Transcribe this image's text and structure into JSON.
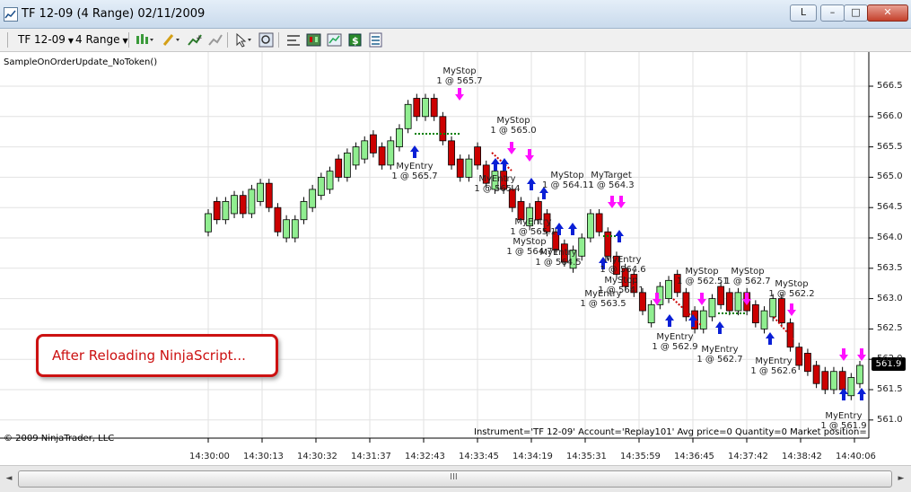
{
  "window": {
    "title": "TF 12-09 (4 Range)  02/11/2009",
    "btn_l": "L",
    "btn_min": "–",
    "btn_max": "□",
    "btn_close": "✕"
  },
  "toolbar": {
    "instrument": "TF 12-09",
    "period": "4 Range",
    "icons": [
      "chart-style-icon",
      "draw-pencil-icon",
      "add-indicator-icon",
      "remove-indicator-icon",
      "cursor-icon",
      "zoom-icon",
      "properties-icon",
      "data-box-icon",
      "chart-trader-icon",
      "strategy-icon",
      "template-icon"
    ]
  },
  "chart": {
    "indicator_label": "SampleOnOrderUpdate_NoToken()",
    "copyright": "© 2009 NinjaTrader, LLC",
    "info_line": "Instrument='TF 12-09' Account='Replay101' Avg price=0 Quantity=0 Market position=",
    "current_price": "561.9",
    "callout": "After Reloading NinjaScript...",
    "y_ticks": [
      "566.5",
      "566.0",
      "565.5",
      "565.0",
      "564.5",
      "564.0",
      "563.5",
      "563.0",
      "562.5",
      "562.0",
      "561.5",
      "561.0"
    ],
    "x_ticks": [
      "14:30:00",
      "14:30:13",
      "14:30:32",
      "14:31:37",
      "14:32:43",
      "14:33:45",
      "14:34:19",
      "14:35:31",
      "14:35:59",
      "14:36:45",
      "14:37:42",
      "14:38:42",
      "14:40:06"
    ],
    "colors": {
      "up": "#90ee90",
      "down": "#cc0000",
      "entry_arrow": "#0a1fd6",
      "stop_arrow": "#ff10ff",
      "dotted_link": "#008000",
      "dotted_stop": "#cc0000"
    },
    "order_labels": [
      {
        "name": "MyStop",
        "value": "1 @ 565.7"
      },
      {
        "name": "MyEntry",
        "value": "1 @ 565.7"
      },
      {
        "name": "MyStop",
        "value": "1 @ 565.0"
      },
      {
        "name": "MyEntry",
        "value": "1 @ 565.4"
      },
      {
        "name": "MyStop",
        "value": "1 @ 564.11"
      },
      {
        "name": "MyTarget",
        "value": "1 @ 564.3"
      },
      {
        "name": "MyEntry",
        "value": "1 @ 565.1"
      },
      {
        "name": "MyStop",
        "value": "1 @ 564.7"
      },
      {
        "name": "MyEntry",
        "value": "1 @ 564.5"
      },
      {
        "name": "MyEntry",
        "value": "1 @ 564.6"
      },
      {
        "name": "MyStop",
        "value": "1 @ 564.1"
      },
      {
        "name": "MyEntry",
        "value": "1 @ 563.5"
      },
      {
        "name": "MyStop",
        "value": "1 @ 562.51"
      },
      {
        "name": "MyStop",
        "value": "1 @ 562.7"
      },
      {
        "name": "MyStop",
        "value": "1 @ 562.2"
      },
      {
        "name": "MyEntry",
        "value": "1 @ 562.9"
      },
      {
        "name": "MyEntry",
        "value": "1 @ 562.7"
      },
      {
        "name": "MyEntry",
        "value": "1 @ 562.6"
      },
      {
        "name": "MyEntry",
        "value": "1 @ 561.9"
      }
    ]
  },
  "scrollbar": {
    "left_arrow": "◄",
    "right_arrow": "►",
    "grip": "III"
  }
}
